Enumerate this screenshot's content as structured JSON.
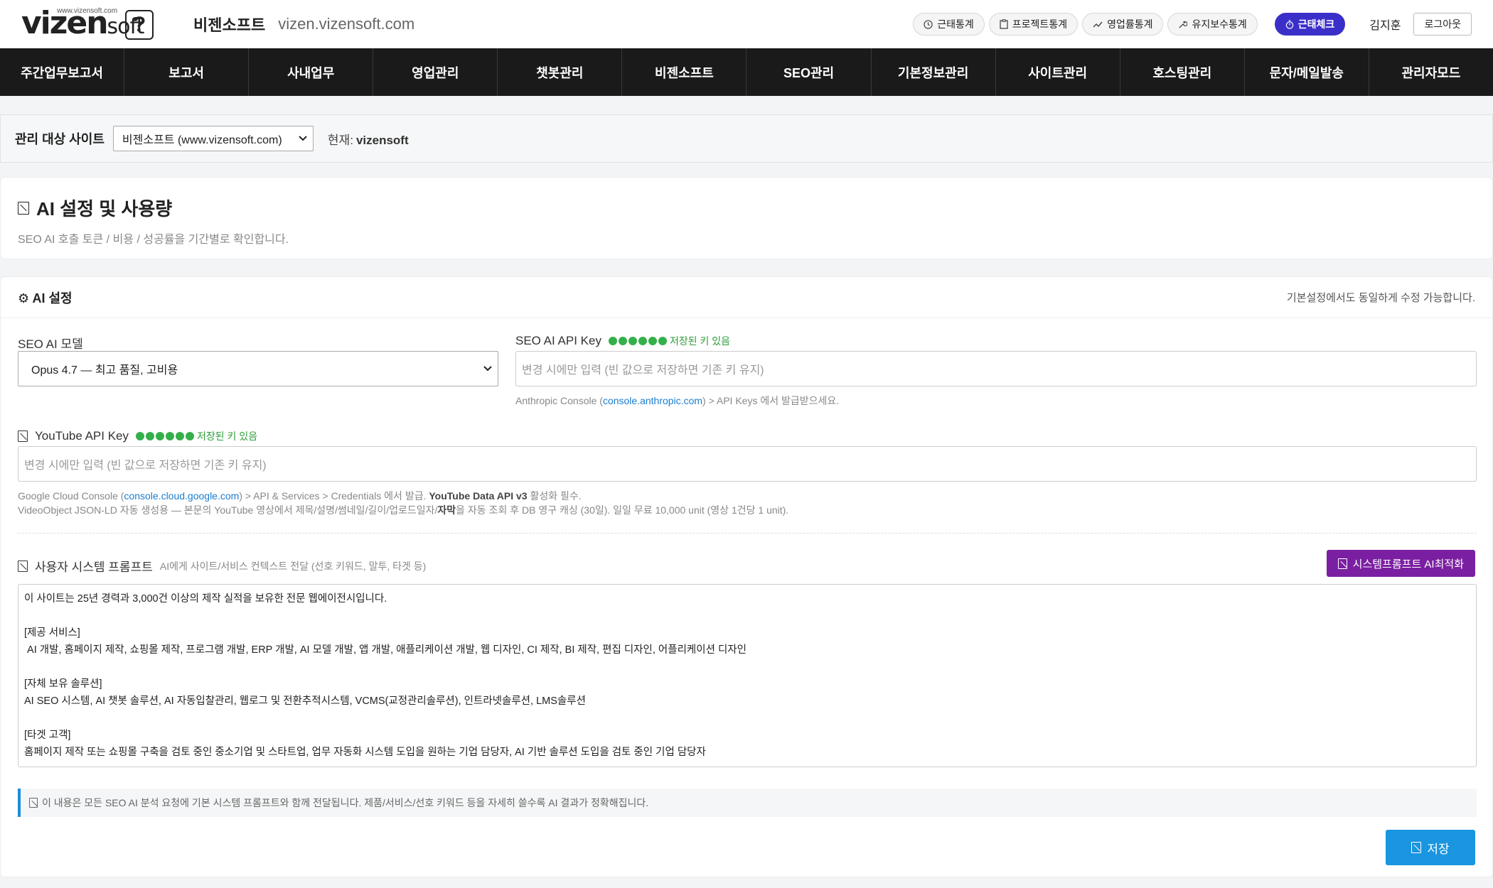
{
  "header": {
    "logo_url_text": "www.vizensoft.com",
    "logo_text_main": "vizen",
    "logo_text_soft": "soft",
    "brand": "비젠소프트",
    "domain": "vizen.vizensoft.com",
    "pills": [
      {
        "label": "근태통계",
        "icon": "clock-icon"
      },
      {
        "label": "프로젝트통계",
        "icon": "clipboard-icon"
      },
      {
        "label": "영업률통계",
        "icon": "trend-icon"
      },
      {
        "label": "유지보수통계",
        "icon": "wrench-icon"
      }
    ],
    "attendance_check": "근태체크",
    "user_name": "김지훈",
    "logout": "로그아웃"
  },
  "nav": [
    "주간업무보고서",
    "보고서",
    "사내업무",
    "영업관리",
    "챗봇관리",
    "비젠소프트",
    "SEO관리",
    "기본정보관리",
    "사이트관리",
    "호스팅관리",
    "문자/메일발송",
    "관리자모드"
  ],
  "site_bar": {
    "label": "관리 대상 사이트",
    "selected": "비젠소프트 (www.vizensoft.com)",
    "current_label": "현재:",
    "current_value": "vizensoft"
  },
  "page": {
    "title": "AI 설정 및 사용량",
    "subtitle": "SEO AI 호출 토큰 / 비용 / 성공률을 기간별로 확인합니다."
  },
  "settings": {
    "title": "⚙ AI 설정",
    "note": "기본설정에서도 동일하게 수정 가능합니다.",
    "model_label": "SEO AI 모델",
    "model_selected": "Opus 4.7 — 최고 품질, 고비용",
    "api_key_label": "SEO AI API Key",
    "stored_text": "저장된 키 있음",
    "api_key_placeholder": "변경 시에만 입력 (빈 값으로 저장하면 기존 키 유지)",
    "api_help_pre": "Anthropic Console (",
    "api_help_link": "console.anthropic.com",
    "api_help_post": ") > API Keys 에서 발급받으세요.",
    "youtube_label": "YouTube API Key",
    "youtube_stored_text": "저장된 키 있음",
    "youtube_placeholder": "변경 시에만 입력 (빈 값으로 저장하면 기존 키 유지)",
    "youtube_help1_pre": "Google Cloud Console (",
    "youtube_help1_link": "console.cloud.google.com",
    "youtube_help1_mid": ") > API & Services > Credentials 에서 발급.",
    "youtube_help1_bold": "YouTube Data API v3",
    "youtube_help1_post": "활성화 필수.",
    "youtube_help2_pre": "VideoObject JSON-LD 자동 생성용 — 본문의 YouTube 영상에서 제목/설명/썸네일/길이/업로드일자/",
    "youtube_help2_bold": "자막",
    "youtube_help2_post": "을 자동 조회 후 DB 영구 캐싱 (30일). 일일 무료 10,000 unit (영상 1건당 1 unit).",
    "prompt_label": "사용자 시스템 프롬프트",
    "prompt_hint": "AI에게 사이트/서비스 컨텍스트 전달 (선호 키워드, 말투, 타겟 등)",
    "optimize_button": "시스템프롬프트 AI최적화",
    "prompt_text": "이 사이트는 25년 경력과 3,000건 이상의 제작 실적을 보유한 전문 웹에이전시입니다.\n\n[제공 서비스]\n AI 개발, 홈페이지 제작, 쇼핑몰 제작, 프로그램 개발, ERP 개발, AI 모델 개발, 앱 개발, 애플리케이션 개발, 웹 디자인, CI 제작, BI 제작, 편집 디자인, 어플리케이션 디자인\n\n[자체 보유 솔루션]\nAI SEO 시스템, AI 챗봇 솔루션, AI 자동입찰관리, 웹로그 및 전환추적시스템, VCMS(교정관리솔루션), 인트라넷솔루션, LMS솔루션\n\n[타겟 고객]\n홈페이지 제작 또는 쇼핑몰 구축을 검토 중인 중소기업 및 스타트업, 업무 자동화 시스템 도입을 원하는 기업 담당자, AI 기반 솔루션 도입을 검토 중인 기업 담당자",
    "info_text": "이 내용은 모든 SEO AI 분석 요청에 기본 시스템 프롬프트와 함께 전달됩니다. 제품/서비스/선호 키워드 등을 자세히 쓸수록 AI 결과가 정확해집니다.",
    "save_button": "저장"
  }
}
